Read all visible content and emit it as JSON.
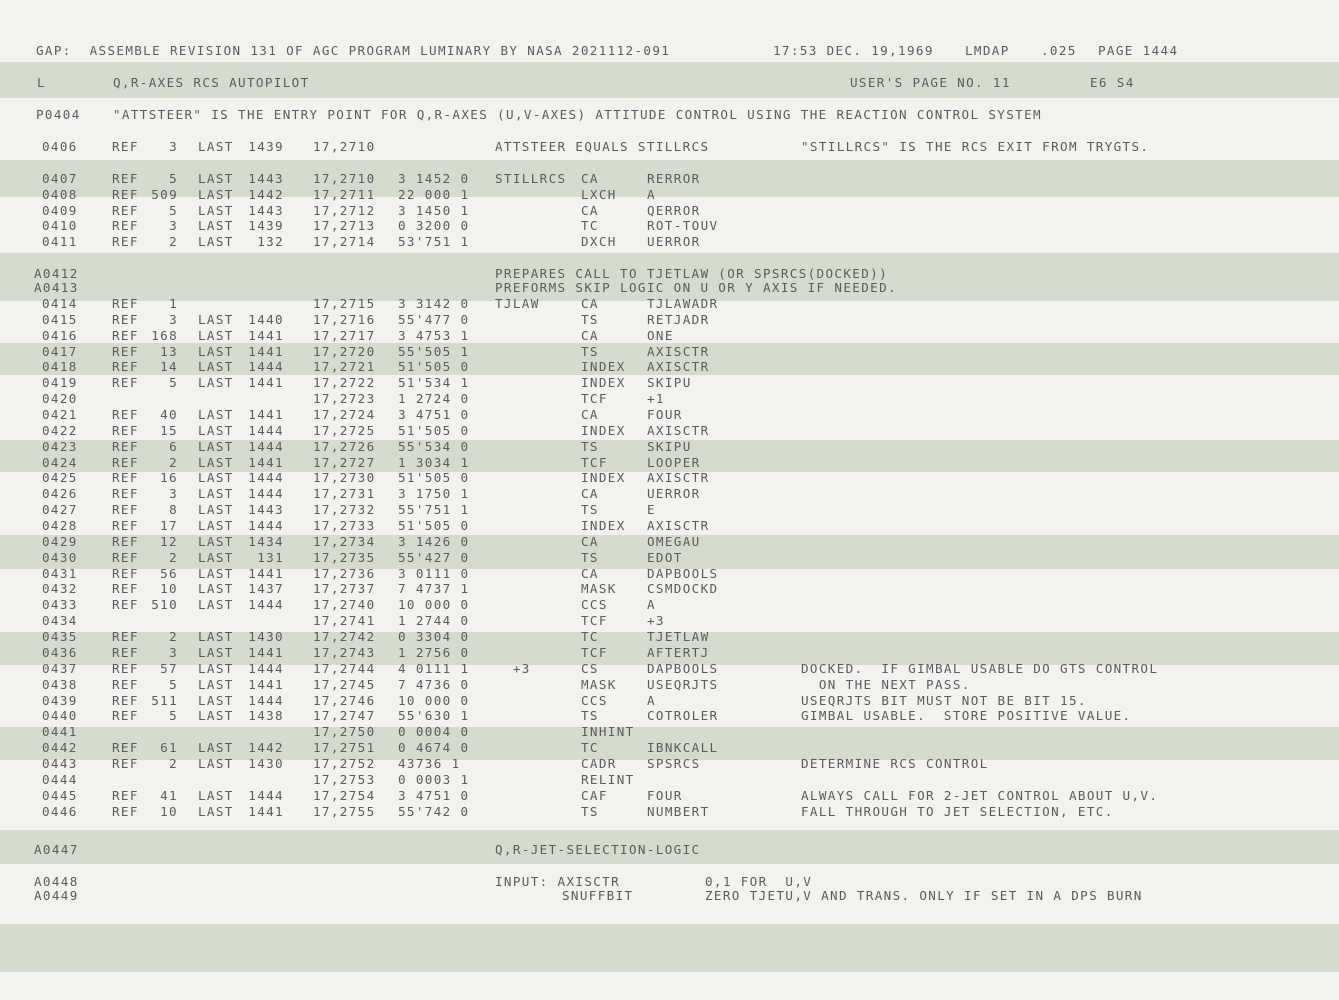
{
  "header": {
    "title": "GAP:  ASSEMBLE REVISION 131 OF AGC PROGRAM LUMINARY BY NASA 2021112-091",
    "timestamp": "17:53 DEC. 19,1969",
    "mode": "LMDAP",
    "code": ".025",
    "page": "PAGE 1444"
  },
  "subheader": {
    "l": "L",
    "section": "Q,R-AXES RCS AUTOPILOT",
    "user_page": "USER'S PAGE NO. 11",
    "code": "E6 S4"
  },
  "p0404": {
    "label": "P0404",
    "text": "\"ATTSTEER\" IS THE ENTRY POINT FOR Q,R-AXES (U,V-AXES) ATTITUDE CONTROL USING THE REACTION CONTROL SYSTEM"
  },
  "l0406": {
    "line": "0406",
    "ref": "REF",
    "refn": "3",
    "last": "LAST",
    "lastn": "1439",
    "addr": "17,2710",
    "text": "ATTSTEER EQUALS STILLRCS",
    "comment": "\"STILLRCS\" IS THE RCS EXIT FROM TRYGTS."
  },
  "rows1": [
    {
      "line": "0407",
      "ref": "REF",
      "refn": "5",
      "last": "LAST",
      "lastn": "1443",
      "addr": "17,2710",
      "word": "3 1452 0",
      "lbl": "STILLRCS",
      "op": "CA",
      "opd": "RERROR",
      "cmt": ""
    },
    {
      "line": "0408",
      "ref": "REF",
      "refn": "509",
      "last": "LAST",
      "lastn": "1442",
      "addr": "17,2711",
      "word": "22 000 1",
      "lbl": "",
      "op": "LXCH",
      "opd": "A",
      "cmt": ""
    },
    {
      "line": "0409",
      "ref": "REF",
      "refn": "5",
      "last": "LAST",
      "lastn": "1443",
      "addr": "17,2712",
      "word": "3 1450 1",
      "lbl": "",
      "op": "CA",
      "opd": "QERROR",
      "cmt": ""
    },
    {
      "line": "0410",
      "ref": "REF",
      "refn": "3",
      "last": "LAST",
      "lastn": "1439",
      "addr": "17,2713",
      "word": "0 3200 0",
      "lbl": "",
      "op": "TC",
      "opd": "ROT-TOUV",
      "cmt": ""
    },
    {
      "line": "0411",
      "ref": "REF",
      "refn": "2",
      "last": "LAST",
      "lastn": "132",
      "addr": "17,2714",
      "word": "53'751 1",
      "lbl": "",
      "op": "DXCH",
      "opd": "UERROR",
      "cmt": ""
    }
  ],
  "a0412": {
    "line": "A0412",
    "text": "PREPARES CALL TO TJETLAW (OR SPSRCS(DOCKED))"
  },
  "a0413": {
    "line": "A0413",
    "text": "PREFORMS SKIP LOGIC ON U OR Y AXIS IF NEEDED."
  },
  "rows2": [
    {
      "line": "0414",
      "ref": "REF",
      "refn": "1",
      "last": "",
      "lastn": "",
      "addr": "17,2715",
      "word": "3 3142 0",
      "lbl": "TJLAW",
      "op": "CA",
      "opd": "TJLAWADR",
      "cmt": ""
    },
    {
      "line": "0415",
      "ref": "REF",
      "refn": "3",
      "last": "LAST",
      "lastn": "1440",
      "addr": "17,2716",
      "word": "55'477 0",
      "lbl": "",
      "op": "TS",
      "opd": "RETJADR",
      "cmt": ""
    },
    {
      "line": "0416",
      "ref": "REF",
      "refn": "168",
      "last": "LAST",
      "lastn": "1441",
      "addr": "17,2717",
      "word": "3 4753 1",
      "lbl": "",
      "op": "CA",
      "opd": "ONE",
      "cmt": ""
    },
    {
      "line": "0417",
      "ref": "REF",
      "refn": "13",
      "last": "LAST",
      "lastn": "1441",
      "addr": "17,2720",
      "word": "55'505 1",
      "lbl": "",
      "op": "TS",
      "opd": "AXISCTR",
      "cmt": ""
    },
    {
      "line": "0418",
      "ref": "REF",
      "refn": "14",
      "last": "LAST",
      "lastn": "1444",
      "addr": "17,2721",
      "word": "51'505 0",
      "lbl": "",
      "op": "INDEX",
      "opd": "AXISCTR",
      "cmt": ""
    },
    {
      "line": "0419",
      "ref": "REF",
      "refn": "5",
      "last": "LAST",
      "lastn": "1441",
      "addr": "17,2722",
      "word": "51'534 1",
      "lbl": "",
      "op": "INDEX",
      "opd": "SKIPU",
      "cmt": ""
    },
    {
      "line": "0420",
      "ref": "",
      "refn": "",
      "last": "",
      "lastn": "",
      "addr": "17,2723",
      "word": "1 2724 0",
      "lbl": "",
      "op": "TCF",
      "opd": "+1",
      "cmt": ""
    },
    {
      "line": "0421",
      "ref": "REF",
      "refn": "40",
      "last": "LAST",
      "lastn": "1441",
      "addr": "17,2724",
      "word": "3 4751 0",
      "lbl": "",
      "op": "CA",
      "opd": "FOUR",
      "cmt": ""
    },
    {
      "line": "0422",
      "ref": "REF",
      "refn": "15",
      "last": "LAST",
      "lastn": "1444",
      "addr": "17,2725",
      "word": "51'505 0",
      "lbl": "",
      "op": "INDEX",
      "opd": "AXISCTR",
      "cmt": ""
    },
    {
      "line": "0423",
      "ref": "REF",
      "refn": "6",
      "last": "LAST",
      "lastn": "1444",
      "addr": "17,2726",
      "word": "55'534 0",
      "lbl": "",
      "op": "TS",
      "opd": "SKIPU",
      "cmt": ""
    },
    {
      "line": "0424",
      "ref": "REF",
      "refn": "2",
      "last": "LAST",
      "lastn": "1441",
      "addr": "17,2727",
      "word": "1 3034 1",
      "lbl": "",
      "op": "TCF",
      "opd": "LOOPER",
      "cmt": ""
    },
    {
      "line": "0425",
      "ref": "REF",
      "refn": "16",
      "last": "LAST",
      "lastn": "1444",
      "addr": "17,2730",
      "word": "51'505 0",
      "lbl": "",
      "op": "INDEX",
      "opd": "AXISCTR",
      "cmt": ""
    },
    {
      "line": "0426",
      "ref": "REF",
      "refn": "3",
      "last": "LAST",
      "lastn": "1444",
      "addr": "17,2731",
      "word": "3 1750 1",
      "lbl": "",
      "op": "CA",
      "opd": "UERROR",
      "cmt": ""
    },
    {
      "line": "0427",
      "ref": "REF",
      "refn": "8",
      "last": "LAST",
      "lastn": "1443",
      "addr": "17,2732",
      "word": "55'751 1",
      "lbl": "",
      "op": "TS",
      "opd": "E",
      "cmt": ""
    },
    {
      "line": "0428",
      "ref": "REF",
      "refn": "17",
      "last": "LAST",
      "lastn": "1444",
      "addr": "17,2733",
      "word": "51'505 0",
      "lbl": "",
      "op": "INDEX",
      "opd": "AXISCTR",
      "cmt": ""
    },
    {
      "line": "0429",
      "ref": "REF",
      "refn": "12",
      "last": "LAST",
      "lastn": "1434",
      "addr": "17,2734",
      "word": "3 1426 0",
      "lbl": "",
      "op": "CA",
      "opd": "OMEGAU",
      "cmt": ""
    },
    {
      "line": "0430",
      "ref": "REF",
      "refn": "2",
      "last": "LAST",
      "lastn": "131",
      "addr": "17,2735",
      "word": "55'427 0",
      "lbl": "",
      "op": "TS",
      "opd": "EDOT",
      "cmt": ""
    },
    {
      "line": "0431",
      "ref": "REF",
      "refn": "56",
      "last": "LAST",
      "lastn": "1441",
      "addr": "17,2736",
      "word": "3 0111 0",
      "lbl": "",
      "op": "CA",
      "opd": "DAPBOOLS",
      "cmt": ""
    },
    {
      "line": "0432",
      "ref": "REF",
      "refn": "10",
      "last": "LAST",
      "lastn": "1437",
      "addr": "17,2737",
      "word": "7 4737 1",
      "lbl": "",
      "op": "MASK",
      "opd": "CSMDOCKD",
      "cmt": ""
    },
    {
      "line": "0433",
      "ref": "REF",
      "refn": "510",
      "last": "LAST",
      "lastn": "1444",
      "addr": "17,2740",
      "word": "10 000 0",
      "lbl": "",
      "op": "CCS",
      "opd": "A",
      "cmt": ""
    },
    {
      "line": "0434",
      "ref": "",
      "refn": "",
      "last": "",
      "lastn": "",
      "addr": "17,2741",
      "word": "1 2744 0",
      "lbl": "",
      "op": "TCF",
      "opd": "+3",
      "cmt": ""
    },
    {
      "line": "0435",
      "ref": "REF",
      "refn": "2",
      "last": "LAST",
      "lastn": "1430",
      "addr": "17,2742",
      "word": "0 3304 0",
      "lbl": "",
      "op": "TC",
      "opd": "TJETLAW",
      "cmt": ""
    },
    {
      "line": "0436",
      "ref": "REF",
      "refn": "3",
      "last": "LAST",
      "lastn": "1441",
      "addr": "17,2743",
      "word": "1 2756 0",
      "lbl": "",
      "op": "TCF",
      "opd": "AFTERTJ",
      "cmt": ""
    },
    {
      "line": "0437",
      "ref": "REF",
      "refn": "57",
      "last": "LAST",
      "lastn": "1444",
      "addr": "17,2744",
      "word": "4 0111 1",
      "lbl": "  +3",
      "op": "CS",
      "opd": "DAPBOOLS",
      "cmt": "DOCKED.  IF GIMBAL USABLE DO GTS CONTROL"
    },
    {
      "line": "0438",
      "ref": "REF",
      "refn": "5",
      "last": "LAST",
      "lastn": "1441",
      "addr": "17,2745",
      "word": "7 4736 0",
      "lbl": "",
      "op": "MASK",
      "opd": "USEQRJTS",
      "cmt": "  ON THE NEXT PASS."
    },
    {
      "line": "0439",
      "ref": "REF",
      "refn": "511",
      "last": "LAST",
      "lastn": "1444",
      "addr": "17,2746",
      "word": "10 000 0",
      "lbl": "",
      "op": "CCS",
      "opd": "A",
      "cmt": "USEQRJTS BIT MUST NOT BE BIT 15."
    },
    {
      "line": "0440",
      "ref": "REF",
      "refn": "5",
      "last": "LAST",
      "lastn": "1438",
      "addr": "17,2747",
      "word": "55'630 1",
      "lbl": "",
      "op": "TS",
      "opd": "COTROLER",
      "cmt": "GIMBAL USABLE.  STORE POSITIVE VALUE."
    },
    {
      "line": "0441",
      "ref": "",
      "refn": "",
      "last": "",
      "lastn": "",
      "addr": "17,2750",
      "word": "0 0004 0",
      "lbl": "",
      "op": "INHINT",
      "opd": "",
      "cmt": ""
    },
    {
      "line": "0442",
      "ref": "REF",
      "refn": "61",
      "last": "LAST",
      "lastn": "1442",
      "addr": "17,2751",
      "word": "0 4674 0",
      "lbl": "",
      "op": "TC",
      "opd": "IBNKCALL",
      "cmt": ""
    },
    {
      "line": "0443",
      "ref": "REF",
      "refn": "2",
      "last": "LAST",
      "lastn": "1430",
      "addr": "17,2752",
      "word": "43736 1",
      "lbl": "",
      "op": "CADR",
      "opd": "SPSRCS",
      "cmt": "DETERMINE RCS CONTROL"
    },
    {
      "line": "0444",
      "ref": "",
      "refn": "",
      "last": "",
      "lastn": "",
      "addr": "17,2753",
      "word": "0 0003 1",
      "lbl": "",
      "op": "RELINT",
      "opd": "",
      "cmt": ""
    },
    {
      "line": "0445",
      "ref": "REF",
      "refn": "41",
      "last": "LAST",
      "lastn": "1444",
      "addr": "17,2754",
      "word": "3 4751 0",
      "lbl": "",
      "op": "CAF",
      "opd": "FOUR",
      "cmt": "ALWAYS CALL FOR 2-JET CONTROL ABOUT U,V."
    },
    {
      "line": "0446",
      "ref": "REF",
      "refn": "10",
      "last": "LAST",
      "lastn": "1441",
      "addr": "17,2755",
      "word": "55'742 0",
      "lbl": "",
      "op": "TS",
      "opd": "NUMBERT",
      "cmt": "FALL THROUGH TO JET SELECTION, ETC."
    }
  ],
  "a0447": {
    "line": "A0447",
    "text": "Q,R-JET-SELECTION-LOGIC"
  },
  "a0448": {
    "line": "A0448",
    "label": "INPUT: AXISCTR",
    "value": "0,1 FOR  U,V"
  },
  "a0449": {
    "line": "A0449",
    "label": "SNUFFBIT",
    "value": "ZERO TJETU,V AND TRANS. ONLY IF SET IN A DPS BURN"
  }
}
